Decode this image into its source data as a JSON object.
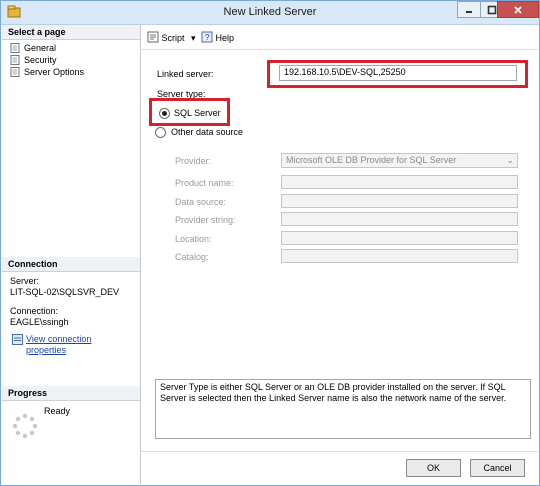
{
  "window": {
    "title": "New Linked Server"
  },
  "sidebar": {
    "select_header": "Select a page",
    "pages": [
      {
        "label": "General",
        "icon": "page-icon"
      },
      {
        "label": "Security",
        "icon": "page-icon"
      },
      {
        "label": "Server Options",
        "icon": "page-icon"
      }
    ],
    "connection": {
      "header": "Connection",
      "server_label": "Server:",
      "server_value": "LIT-SQL-02\\SQLSVR_DEV",
      "connection_label": "Connection:",
      "connection_value": "EAGLE\\ssingh",
      "view_link": "View connection properties"
    },
    "progress": {
      "header": "Progress",
      "status": "Ready"
    }
  },
  "toolbar": {
    "script_label": "Script",
    "help_label": "Help"
  },
  "form": {
    "linked_server_label": "Linked server:",
    "linked_server_value": "192.168.10.5\\DEV-SQL,25250",
    "server_type_label": "Server type:",
    "sql_server_label": "SQL Server",
    "other_source_label": "Other data source",
    "provider_label": "Provider:",
    "provider_value": "Microsoft OLE DB Provider for SQL Server",
    "product_name_label": "Product name:",
    "data_source_label": "Data source:",
    "provider_string_label": "Provider string:",
    "location_label": "Location:",
    "catalog_label": "Catalog:"
  },
  "description": "Server Type is either SQL Server or an OLE DB provider installed on the server. If SQL Server is selected then the Linked Server name is also the network name of the server.",
  "footer": {
    "ok_label": "OK",
    "cancel_label": "Cancel"
  },
  "colors": {
    "highlight_frame": "#d6222a",
    "link": "#1a47a6"
  }
}
